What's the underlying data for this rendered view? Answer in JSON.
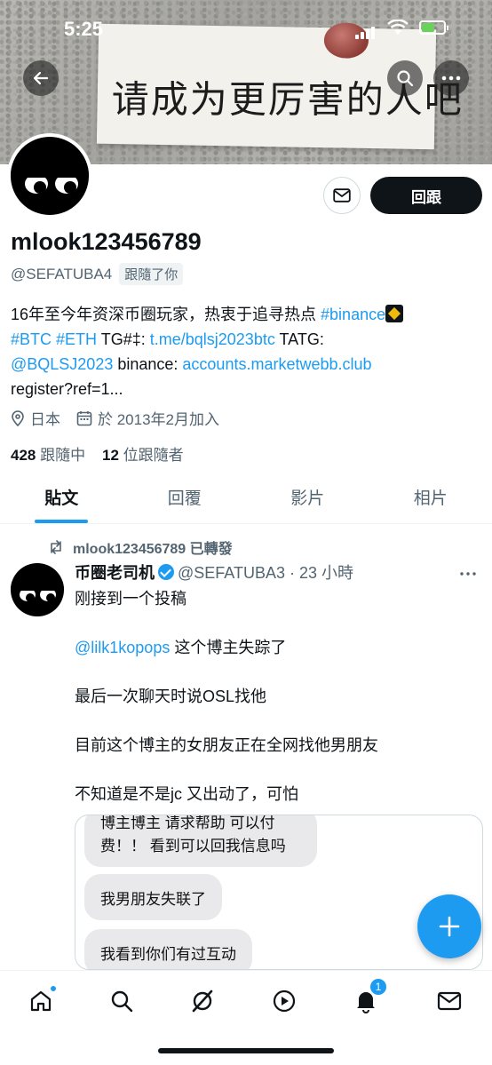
{
  "status_bar": {
    "time": "5:25"
  },
  "banner": {
    "note_text": "请成为更厉害的人吧"
  },
  "profile": {
    "follow_button": "回跟",
    "display_name": "mlook123456789",
    "handle": "@SEFATUBA4",
    "follows_you": "跟隨了你",
    "bio": {
      "line1": "16年至今年资深币圈玩家，热衷于追寻热点 ",
      "tag_binance": "#binance",
      "tag_btc": "#BTC",
      "tag_eth": "#ETH",
      "tg_label": " TG#‡: ",
      "tg_link": "t.me/bqlsj2023btc",
      "tatg_label": " TATG:",
      "mention": "@BQLSJ2023",
      "binance_label": " binance: ",
      "binance_link": "accounts.marketwebb.club",
      "tail": "register?ref=1..."
    },
    "location": "日本",
    "joined": "於 2013年2月加入",
    "following_count": "428",
    "following_label": "跟隨中",
    "followers_count": "12",
    "followers_label": "位跟隨者"
  },
  "tabs": [
    "貼文",
    "回覆",
    "影片",
    "相片"
  ],
  "tweet": {
    "repost_label": "mlook123456789 已轉發",
    "author": "币圈老司机",
    "handle_time": "@SEFATUBA3 · 23 小時",
    "line1": "刚接到一个投稿",
    "mention": "@lilk1kopops",
    "line2_rest": " 这个博主失踪了",
    "line3": "最后一次聊天时说OSL找他",
    "line4": "目前这个博主的女朋友正在全网找他男朋友",
    "line5": "不知道是不是jc 又出动了，可怕",
    "media_bubbles": [
      "博主博主 请求帮助 可以付",
      "费！！ 看到可以回我信息吗",
      "我男朋友失联了",
      "我看到你们有过互动"
    ]
  },
  "bottom_nav": {
    "notifications_badge": "1"
  }
}
